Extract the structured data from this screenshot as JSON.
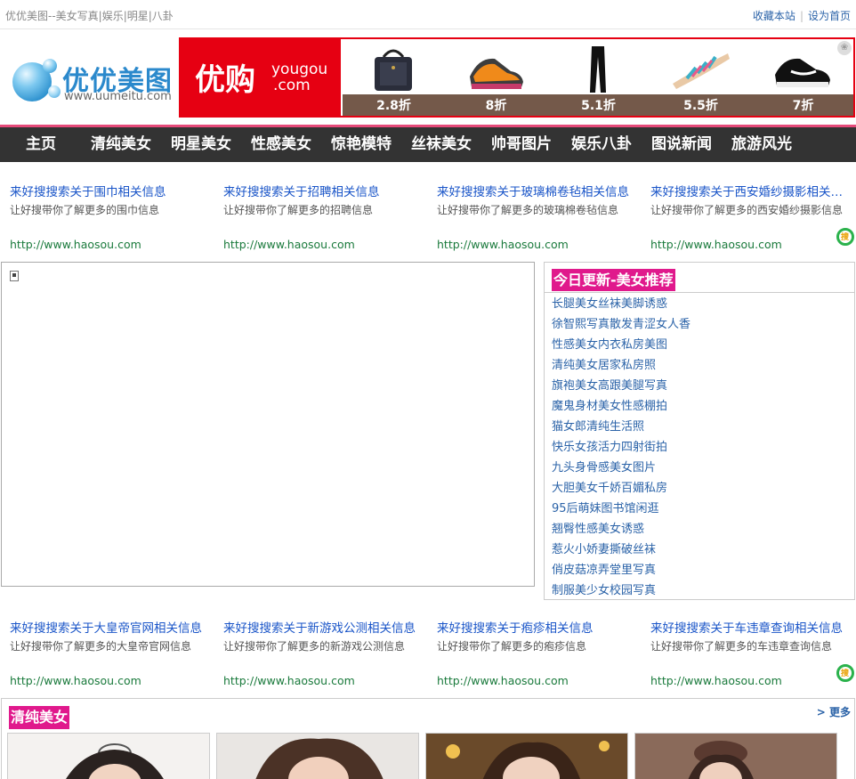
{
  "topbar": {
    "tagline": "优优美图--美女写真|娱乐|明星|八卦",
    "bookmark": "收藏本站",
    "separator": "|",
    "homepage": "设为首页"
  },
  "logo": {
    "name": "优优美图",
    "url": "www.uumeitu.com"
  },
  "banner": {
    "brand_cn": "优购",
    "brand_en1": "yougou",
    "brand_en2": ".com",
    "prices": [
      "2.8折",
      "8折",
      "5.1折",
      "5.5折",
      "7折"
    ]
  },
  "nav": {
    "items": [
      "主页",
      "清纯美女",
      "明星美女",
      "性感美女",
      "惊艳模特",
      "丝袜美女",
      "帅哥图片",
      "娱乐八卦",
      "图说新闻",
      "旅游风光"
    ]
  },
  "ads_top": [
    {
      "title": "来好搜搜索关于围巾相关信息",
      "desc": "让好搜带你了解更多的围巾信息",
      "url": "http://www.haosou.com"
    },
    {
      "title": "来好搜搜索关于招聘相关信息",
      "desc": "让好搜带你了解更多的招聘信息",
      "url": "http://www.haosou.com"
    },
    {
      "title": "来好搜搜索关于玻璃棉卷毡相关信息",
      "desc": "让好搜带你了解更多的玻璃棉卷毡信息",
      "url": "http://www.haosou.com"
    },
    {
      "title": "来好搜搜索关于西安婚纱摄影相关信息",
      "desc": "让好搜带你了解更多的西安婚纱摄影信息",
      "url": "http://www.haosou.com"
    }
  ],
  "ads_bottom": [
    {
      "title": "来好搜搜索关于大皇帝官网相关信息",
      "desc": "让好搜带你了解更多的大皇帝官网信息",
      "url": "http://www.haosou.com"
    },
    {
      "title": "来好搜搜索关于新游戏公测相关信息",
      "desc": "让好搜带你了解更多的新游戏公测信息",
      "url": "http://www.haosou.com"
    },
    {
      "title": "来好搜搜索关于疱疹相关信息",
      "desc": "让好搜带你了解更多的疱疹信息",
      "url": "http://www.haosou.com"
    },
    {
      "title": "来好搜搜索关于车违章查询相关信息",
      "desc": "让好搜带你了解更多的车违章查询信息",
      "url": "http://www.haosou.com"
    }
  ],
  "so_icon_text": "搜",
  "recommend": {
    "title": "今日更新-美女推荐",
    "items": [
      "长腿美女丝袜美脚诱惑",
      "徐智熙写真散发青涩女人香",
      "性感美女内衣私房美图",
      "清纯美女居家私房照",
      "旗袍美女高跟美腿写真",
      "魔鬼身材美女性感棚拍",
      "猫女郎清纯生活照",
      "快乐女孩活力四射街拍",
      "九头身骨感美女图片",
      "大胆美女千娇百媚私房",
      "95后萌妹图书馆闲逛",
      "翘臀性感美女诱惑",
      "惹火小娇妻撕破丝袜",
      "俏皮菇凉弄堂里写真",
      "制服美少女校园写真"
    ]
  },
  "section": {
    "title": "清纯美女",
    "more": "> 更多"
  },
  "colors": {
    "accent_pink": "#e0198c",
    "nav_bg": "#333333",
    "link_blue": "#2b63a8",
    "ad_title_blue": "#1a55c8",
    "ad_url_green": "#1a7a3c",
    "banner_red": "#e60012"
  }
}
